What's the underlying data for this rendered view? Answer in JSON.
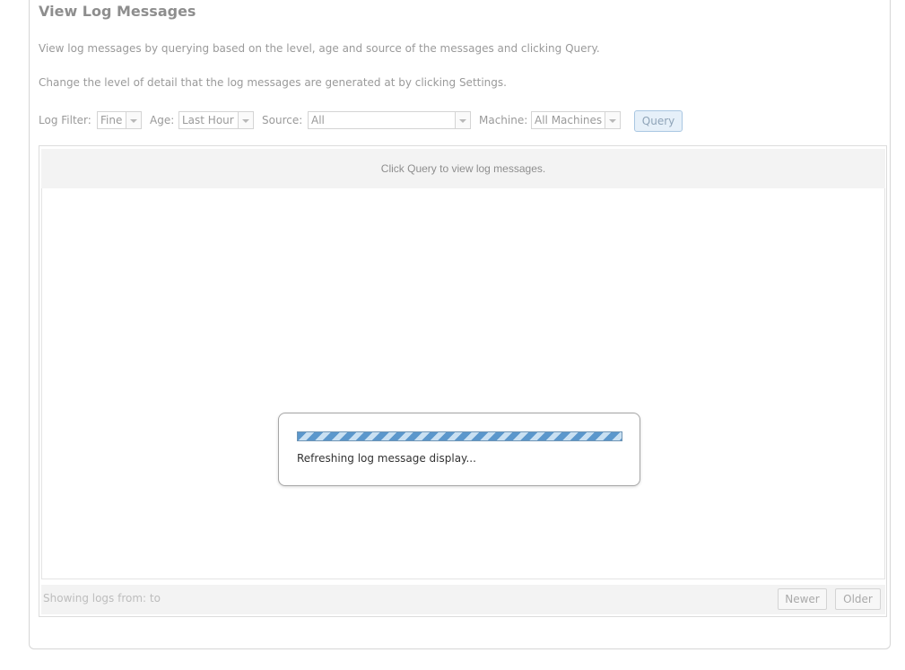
{
  "page": {
    "title": "View Log Messages",
    "description_1": "View log messages by querying based on the level, age and source of the messages and clicking Query.",
    "description_2": "Change the level of detail that the log messages are generated at by clicking Settings."
  },
  "filters": {
    "log_filter_label": "Log Filter:",
    "log_filter_value": "Fine",
    "age_label": "Age:",
    "age_value": "Last Hour",
    "source_label": "Source:",
    "source_value": "All",
    "machine_label": "Machine:",
    "machine_value": "All Machines",
    "query_button": "Query"
  },
  "log_view": {
    "empty_message": "Click Query to view log messages.",
    "showing_text": "Showing logs from:  to",
    "newer_button": "Newer",
    "older_button": "Older"
  },
  "dialog": {
    "progress_text": "Refreshing log message display...",
    "progress": "indeterminate"
  },
  "colors": {
    "query_button_bg": "#e6f0f9",
    "progress_stripe": "#5b97cc",
    "text_muted": "#9a9a9a"
  }
}
